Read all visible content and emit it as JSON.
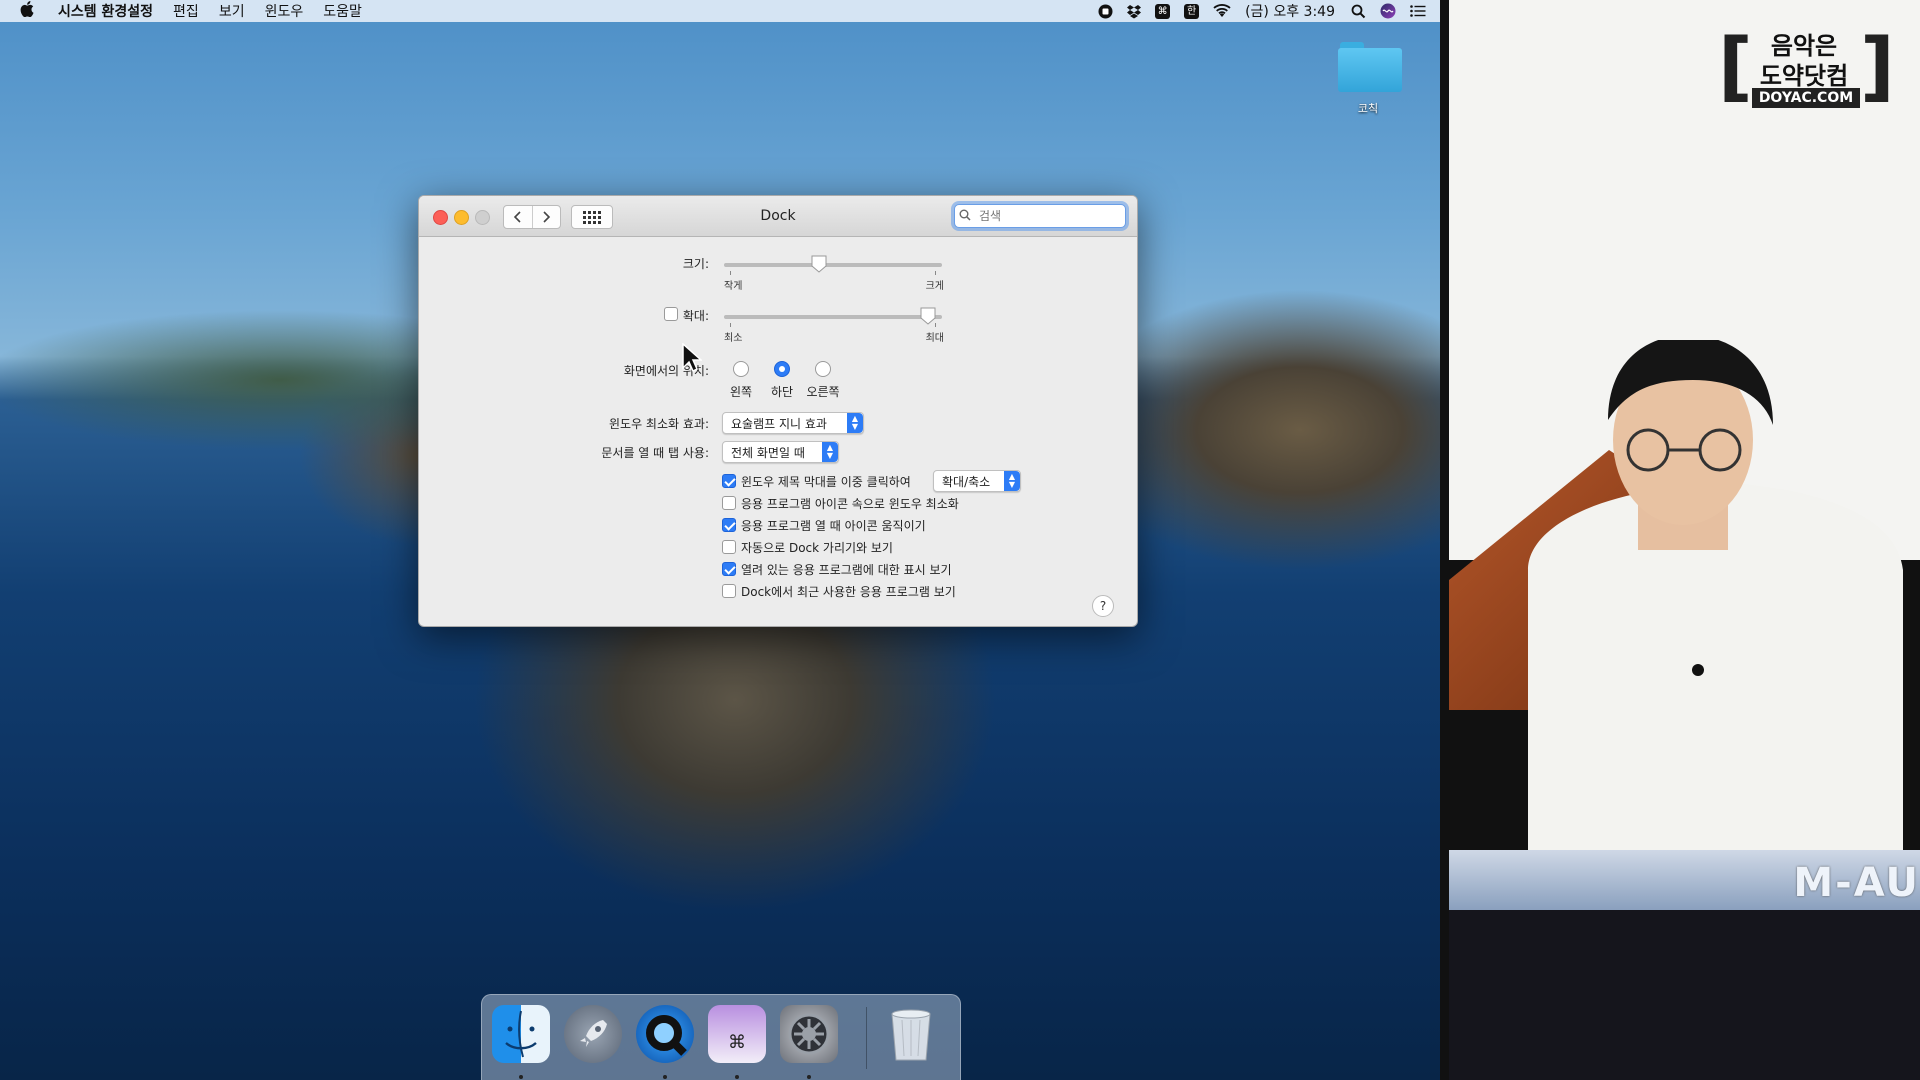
{
  "menubar": {
    "apple": "",
    "items": [
      "시스템 환경설정",
      "편집",
      "보기",
      "윈도우",
      "도움말"
    ],
    "status": {
      "keyboard": "⌘",
      "input_lang": "한",
      "clock": "(금) 오후 3:49"
    }
  },
  "desktop": {
    "folder_label": "코칙"
  },
  "window": {
    "title": "Dock",
    "search_placeholder": "검색",
    "size": {
      "label": "크기:",
      "min_label": "작게",
      "max_label": "크게",
      "value_fraction": 0.43
    },
    "magnification": {
      "label": "확대:",
      "checked": false,
      "min_label": "최소",
      "max_label": "최대",
      "value_fraction": 0.97
    },
    "position": {
      "label": "화면에서의 위치:",
      "options": [
        "왼쪽",
        "하단",
        "오른쪽"
      ],
      "selected": "하단"
    },
    "minimize_effect": {
      "label": "윈도우 최소화 효과:",
      "value": "요술램프 지니 효과"
    },
    "tabs": {
      "label": "문서를 열 때 탭 사용:",
      "value": "전체 화면일 때"
    },
    "options": [
      {
        "label": "윈도우 제목 막대를 이중 클릭하여",
        "checked": true,
        "popup": "확대/축소"
      },
      {
        "label": "응용 프로그램 아이콘 속으로 윈도우 최소화",
        "checked": false
      },
      {
        "label": "응용 프로그램 열 때 아이콘 움직이기",
        "checked": true
      },
      {
        "label": "자동으로 Dock 가리기와 보기",
        "checked": false
      },
      {
        "label": "열려 있는 응용 프로그램에 대한 표시 보기",
        "checked": true
      },
      {
        "label": "Dock에서 최근 사용한 응용 프로그램 보기",
        "checked": false
      }
    ],
    "help": "?"
  },
  "dock": {
    "apps": [
      "finder-icon",
      "launchpad-icon",
      "quicktime-icon",
      "keyboard-app-icon",
      "system-preferences-icon",
      "trash-icon"
    ],
    "running_indicators": [
      true,
      false,
      true,
      true,
      true,
      false
    ]
  },
  "overlay": {
    "logo_line1": "음악은",
    "logo_line2": "도약닷컴",
    "logo_line3": "DOYAC.COM",
    "keyboard_brand": "M-AU"
  },
  "colors": {
    "accent": "#2d7cf6",
    "close": "#fc5f57",
    "minimize": "#fdbc2e"
  }
}
